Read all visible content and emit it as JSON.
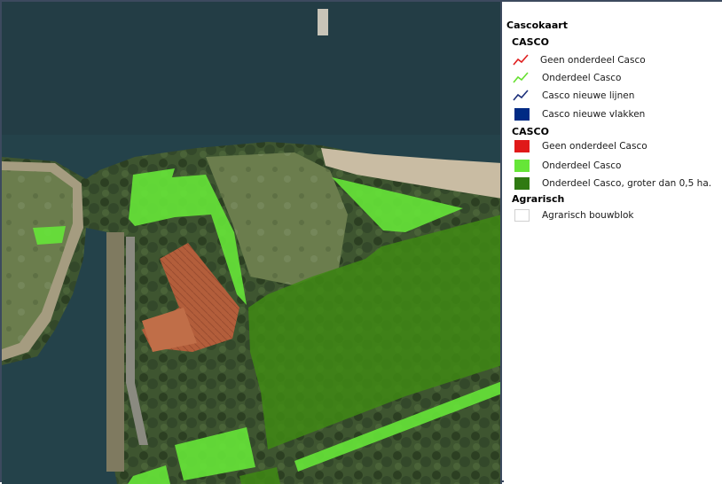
{
  "legend": {
    "title": "Cascokaart",
    "groups": [
      {
        "heading": "CASCO",
        "items": [
          {
            "label": "Geen onderdeel Casco",
            "symbol": "line-icon",
            "color": "#e02020"
          },
          {
            "label": "Onderdeel Casco",
            "symbol": "line-icon",
            "color": "#66e030"
          },
          {
            "label": "Casco nieuwe lijnen",
            "symbol": "line-icon",
            "color": "#1c2f7a"
          },
          {
            "label": "Casco nieuwe vlakken",
            "symbol": "fill-swatch",
            "color": "#002a84"
          }
        ]
      },
      {
        "heading": "CASCO",
        "items": [
          {
            "label": "Geen onderdeel Casco",
            "symbol": "fill-swatch",
            "color": "#e01919"
          },
          {
            "label": "Onderdeel Casco",
            "symbol": "fill-swatch",
            "color": "#66e638"
          },
          {
            "label": "Onderdeel Casco, groter dan 0,5 ha.",
            "symbol": "fill-swatch",
            "color": "#2f7a12"
          }
        ]
      },
      {
        "heading": "Agrarisch",
        "items": [
          {
            "label": "Agrarisch bouwblok",
            "symbol": "fill-swatch",
            "color": "#ffffff"
          }
        ]
      }
    ]
  },
  "colors": {
    "water": "#243e46",
    "land": "#4f6a3a",
    "onderdeel_casco": "#66e638",
    "onderdeel_casco_groot": "#3f8a14",
    "beach": "#c9bca3",
    "roof": "#b5623e"
  }
}
